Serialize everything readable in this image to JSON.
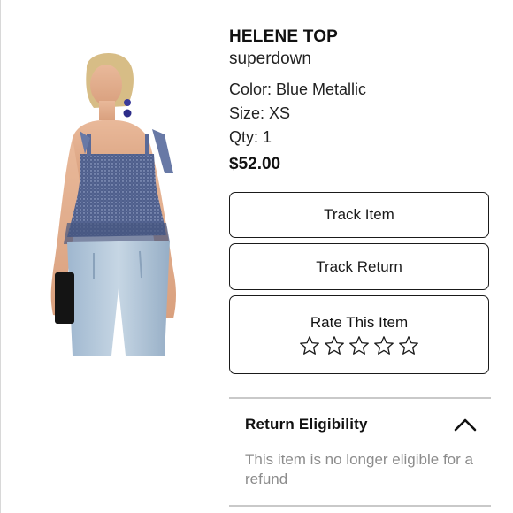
{
  "product": {
    "name": "HELENE TOP",
    "brand": "superdown",
    "color_label": "Color: Blue Metallic",
    "size_label": "Size: XS",
    "qty_label": "Qty: 1",
    "price": "$52.00",
    "image_icon": "product-photo"
  },
  "actions": {
    "track_item": "Track Item",
    "track_return": "Track Return"
  },
  "rating": {
    "label": "Rate This Item",
    "max_stars": 5,
    "current": 0
  },
  "eligibility": {
    "title": "Return Eligibility",
    "expanded": true,
    "message": "This item is no longer eligible for a refund"
  },
  "colors": {
    "text": "#111111",
    "muted": "#8c8c8c",
    "border": "#1a1a1a",
    "divider": "#c9c9c9"
  }
}
